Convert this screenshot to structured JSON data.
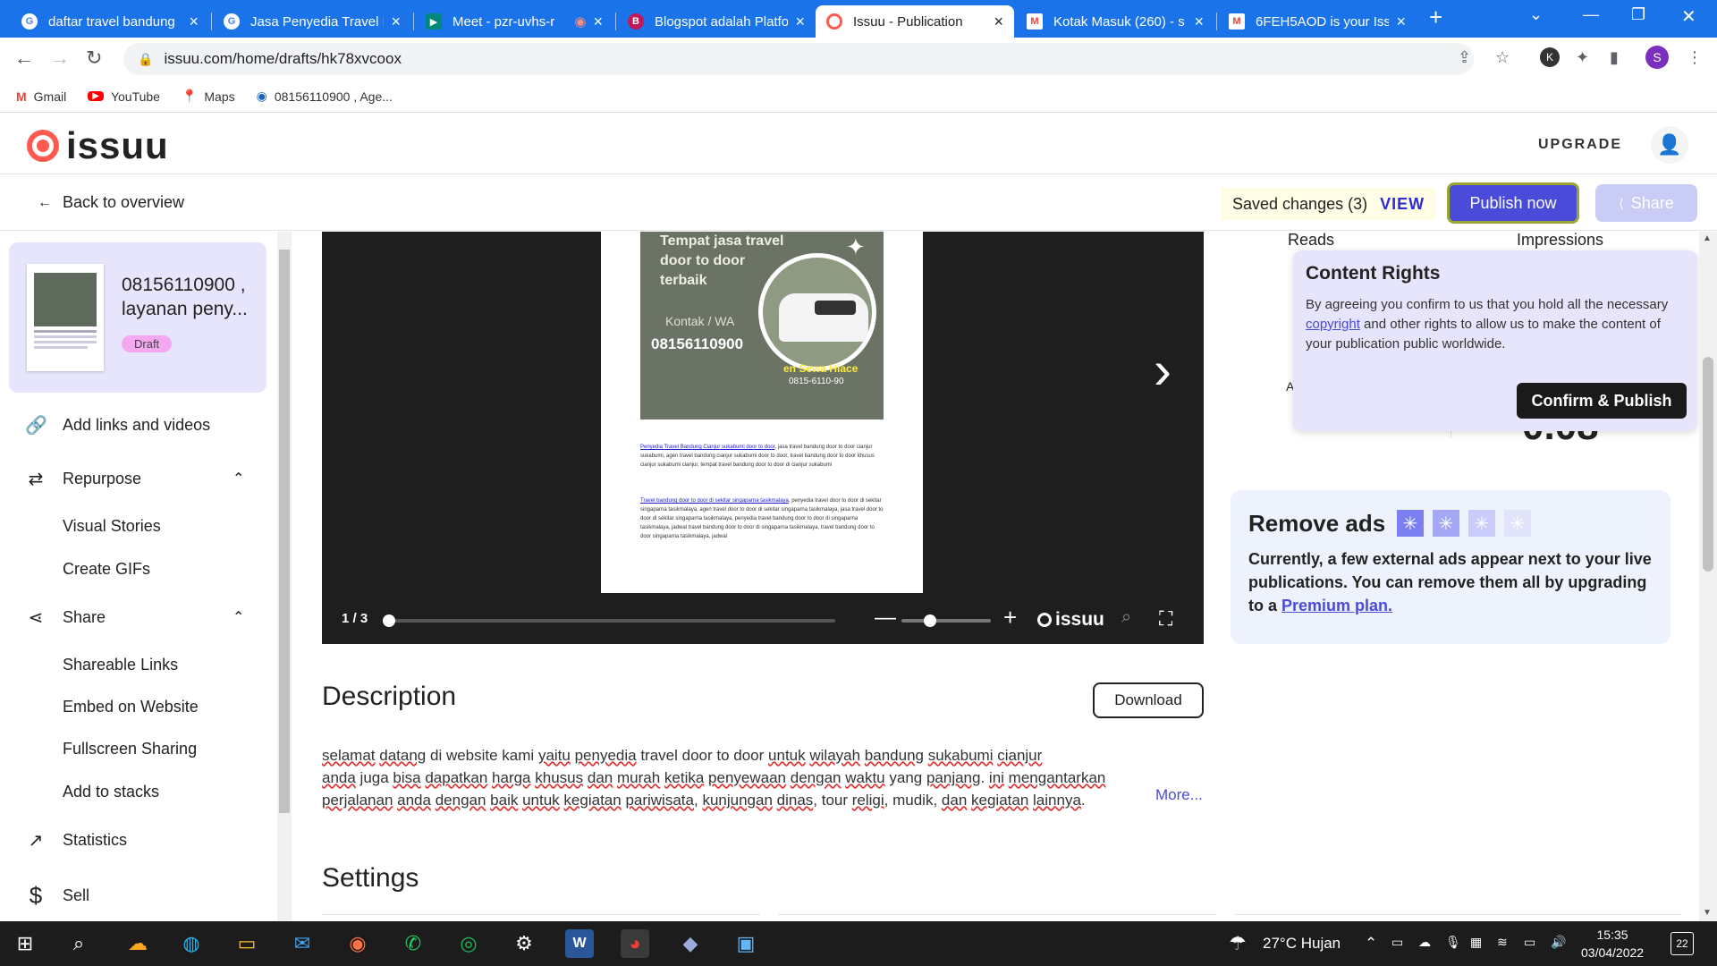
{
  "browser": {
    "tabs": [
      {
        "title": "daftar travel bandung",
        "icon": "google-icon",
        "color": "#4285f4"
      },
      {
        "title": "Jasa Penyedia Travel B",
        "icon": "google-icon",
        "color": "#4285f4"
      },
      {
        "title": "Meet - pzr-uvhs-r",
        "icon": "meet-icon",
        "color": "#00897b"
      },
      {
        "title": "Blogspot adalah Platfo",
        "icon": "blogger-icon",
        "color": "#c2185b"
      },
      {
        "title": "Issuu - Publication",
        "icon": "issuu-icon",
        "color": "#ff5a4f",
        "active": true
      },
      {
        "title": "Kotak Masuk (260) - s",
        "icon": "gmail-icon",
        "color": "#ea4335"
      },
      {
        "title": "6FEH5AOD is your Iss",
        "icon": "gmail-icon",
        "color": "#ea4335"
      }
    ],
    "url": "issuu.com/home/drafts/hk78xvcoox",
    "bookmarks": [
      {
        "label": "Gmail",
        "icon": "gmail-icon"
      },
      {
        "label": "YouTube",
        "icon": "youtube-icon"
      },
      {
        "label": "Maps",
        "icon": "maps-icon"
      },
      {
        "label": "08156110900 , Age...",
        "icon": "site-icon"
      }
    ],
    "profile_initial": "S",
    "ext_initial": "K"
  },
  "header": {
    "logo": "issuu",
    "upgrade": "UPGRADE"
  },
  "subbar": {
    "back": "Back to overview",
    "saved": "Saved changes (3)",
    "view": "VIEW",
    "publish": "Publish now",
    "share": "Share"
  },
  "sidebar": {
    "doc_title": "08156110900 , layanan peny...",
    "badge": "Draft",
    "items": {
      "add_links": "Add links and videos",
      "repurpose": "Repurpose",
      "visual_stories": "Visual Stories",
      "create_gifs": "Create GIFs",
      "share": "Share",
      "shareable_links": "Shareable Links",
      "embed": "Embed on Website",
      "fullscreen": "Fullscreen Sharing",
      "stacks": "Add to stacks",
      "statistics": "Statistics",
      "sell": "Sell"
    }
  },
  "viewer": {
    "page_heading": "Tempat jasa travel door to door terbaik",
    "kontak": "Kontak / WA",
    "phone": "08156110900",
    "sewa": "en Sewa Hiace",
    "sewa_phone": "0815-6110-90",
    "para1_link": "Penyedia Travel Bandung Cianjur sukabumi door to door",
    "para1": ", jasa travel bandung door to door cianjur sukabumi, agen travel bandung cianjur sukabumi door to door, travel bandung door to door khusus cianjur sukabumi cianjur, tempat travel bandung door to door di cianjur sukabumi",
    "para2_link": "Travel bandung door to door di sekitar singaparna tasikmalaya",
    "para2": ", penyedia travel door to door di sekitar singaparna tasikmalaya, agen travel door to door di sekitar singaparna tasikmalaya, jasa travel door to door di sekitar singaparna tasikmalaya, penyedia travel bandung door to door di singaparna tasikmalaya, jadwal travel bandung door to door di singaparna tasikmalaya, travel bandung door to door singaparna tasikmalaya, jadwal",
    "page_num": "1 / 3",
    "progress": 0.0,
    "zoom_level": 0.25,
    "brand": "issuu"
  },
  "description": {
    "title": "Description",
    "download": "Download",
    "more": "More...",
    "words": [
      "selamat",
      " ",
      "datang",
      " di website kami ",
      "yaitu",
      " ",
      "penyedia",
      " travel door to door ",
      "untuk",
      " ",
      "wilayah",
      " ",
      "bandung",
      " ",
      "sukabumi",
      " ",
      "cianjur",
      "\n",
      "anda",
      " juga ",
      "bisa",
      " ",
      "dapatkan",
      " ",
      "harga",
      " ",
      "khusus",
      " ",
      "dan",
      " ",
      "murah",
      " ",
      "ketika",
      " ",
      "penyewaan",
      " ",
      "dengan",
      " ",
      "waktu",
      " yang ",
      "panjang",
      ". ",
      "ini",
      " ",
      "mengantarkan",
      "\n",
      "perjalanan",
      " ",
      "anda",
      " ",
      "dengan",
      " ",
      "baik",
      " ",
      "untuk",
      " ",
      "kegiatan",
      " ",
      "pariwisata",
      ", ",
      "kunjungan",
      " ",
      "dinas",
      ", tour ",
      "religi",
      ", mudik, ",
      "dan",
      " ",
      "kegiatan",
      " ",
      "lainnya",
      "."
    ]
  },
  "settings": {
    "title": "Settings"
  },
  "stats": {
    "reads": "Reads",
    "impressions": "Impressions",
    "impressions_value": "0.08",
    "reads_value": "–",
    "reads_label_partial": "A"
  },
  "rights": {
    "title": "Content Rights",
    "text_before": "By agreeing you confirm to us that you hold all the necessary ",
    "link": "copyright",
    "text_after": " and other rights to allow us to make the content of your publication public worldwide.",
    "confirm": "Confirm & Publish"
  },
  "ads": {
    "title": "Remove ads",
    "text": "Currently, a few external ads appear next to your live publications. You can remove them all by upgrading to a ",
    "link": "Premium plan.",
    "star_colors": [
      "#7b7ff0",
      "#a4a7f3",
      "#c9cbf8",
      "#e1e3fb"
    ]
  },
  "taskbar": {
    "weather": "27°C  Hujan",
    "time": "15:35",
    "date": "03/04/2022",
    "notifications": "22"
  }
}
